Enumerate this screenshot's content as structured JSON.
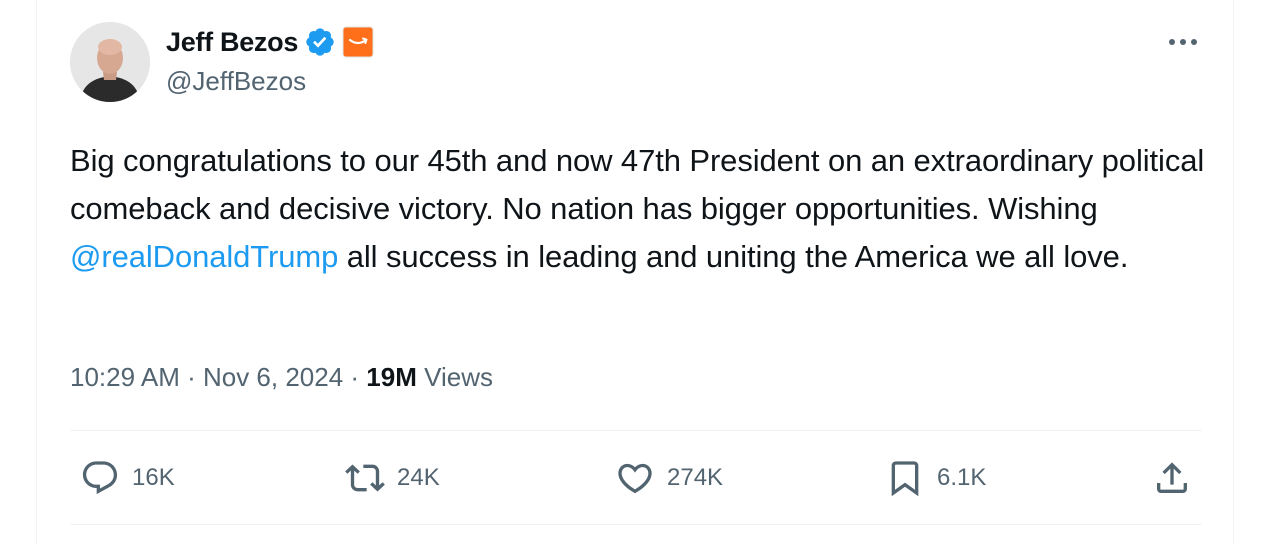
{
  "author": {
    "name": "Jeff Bezos",
    "handle": "@JeffBezos",
    "verified_icon": "verified-badge-icon",
    "affiliate_icon": "amazon-affiliate-icon"
  },
  "tweet": {
    "text_before_mention": "Big congratulations to our 45th and now 47th President on an extraordinary political comeback and decisive victory. No nation has bigger opportunities. Wishing ",
    "mention": "@realDonaldTrump",
    "text_after_mention": " all success in leading and uniting the America we all love.",
    "time": "10:29 AM",
    "separator": " · ",
    "date": "Nov 6, 2024",
    "views_count": "19M",
    "views_label": " Views"
  },
  "actions": {
    "replies": "16K",
    "reposts": "24K",
    "likes": "274K",
    "bookmarks": "6.1K"
  },
  "colors": {
    "text": "#0f1419",
    "secondary": "#536471",
    "link": "#1d9bf0",
    "verified": "#1d9bf0",
    "amazon": "#ff6f1a",
    "divider": "#eff3f4"
  }
}
